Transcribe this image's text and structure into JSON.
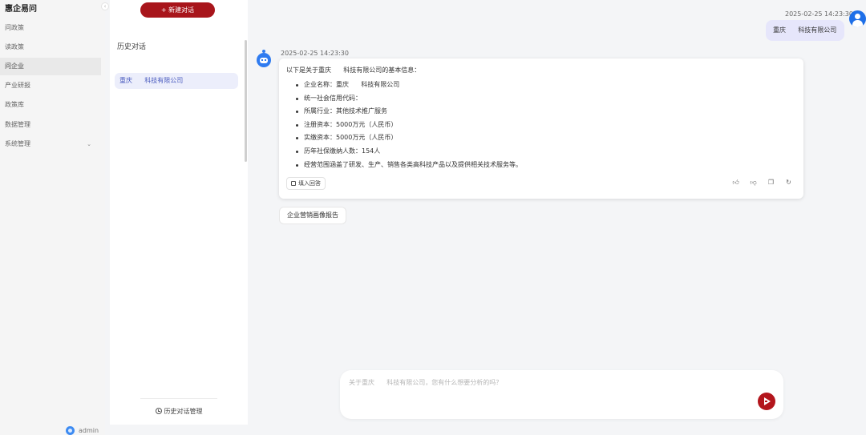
{
  "nav": {
    "title": "惠企易问",
    "collapse_icon": "chevron-left-icon",
    "items": [
      {
        "label": "问政策"
      },
      {
        "label": "读政策"
      },
      {
        "label": "问企业",
        "active": true
      },
      {
        "label": "产业研报"
      },
      {
        "label": "政策库"
      },
      {
        "label": "数据管理"
      },
      {
        "label": "系统管理",
        "has_submenu": true
      }
    ],
    "user": "admin"
  },
  "history": {
    "new_button": "+ 新建对话",
    "title": "历史对话",
    "items": [
      {
        "label": "重庆      科技有限公司"
      }
    ],
    "manage_button": "历史对话管理"
  },
  "chat": {
    "user_message": {
      "timestamp": "2025-02-25 14:23:30",
      "text": "重庆      科技有限公司"
    },
    "bot_message": {
      "timestamp": "2025-02-25 14:23:30",
      "intro": "以下是关于重庆      科技有限公司的基本信息：",
      "items": [
        "企业名称：重庆      科技有限公司",
        "统一社会信用代码：",
        "所属行业：其他技术推广服务",
        "注册资本：5000万元（人民币）",
        "实缴资本：5000万元（人民币）",
        "历年社保缴纳人数：154人",
        "经营范围涵盖了研发、生产、销售各类高科技产品以及提供相关技术服务等。"
      ],
      "fill_button": "填入回答",
      "actions": [
        "thumbs-up-icon",
        "thumbs-down-icon",
        "copy-icon",
        "refresh-icon"
      ]
    },
    "suggestion": "企业营销画像报告",
    "input_placeholder": "关于重庆      科技有限公司，您有什么想要分析的吗？",
    "colors": {
      "brand": "#a8151b",
      "accent": "#2f7bf0",
      "user_bubble": "#e6e6fb"
    }
  }
}
